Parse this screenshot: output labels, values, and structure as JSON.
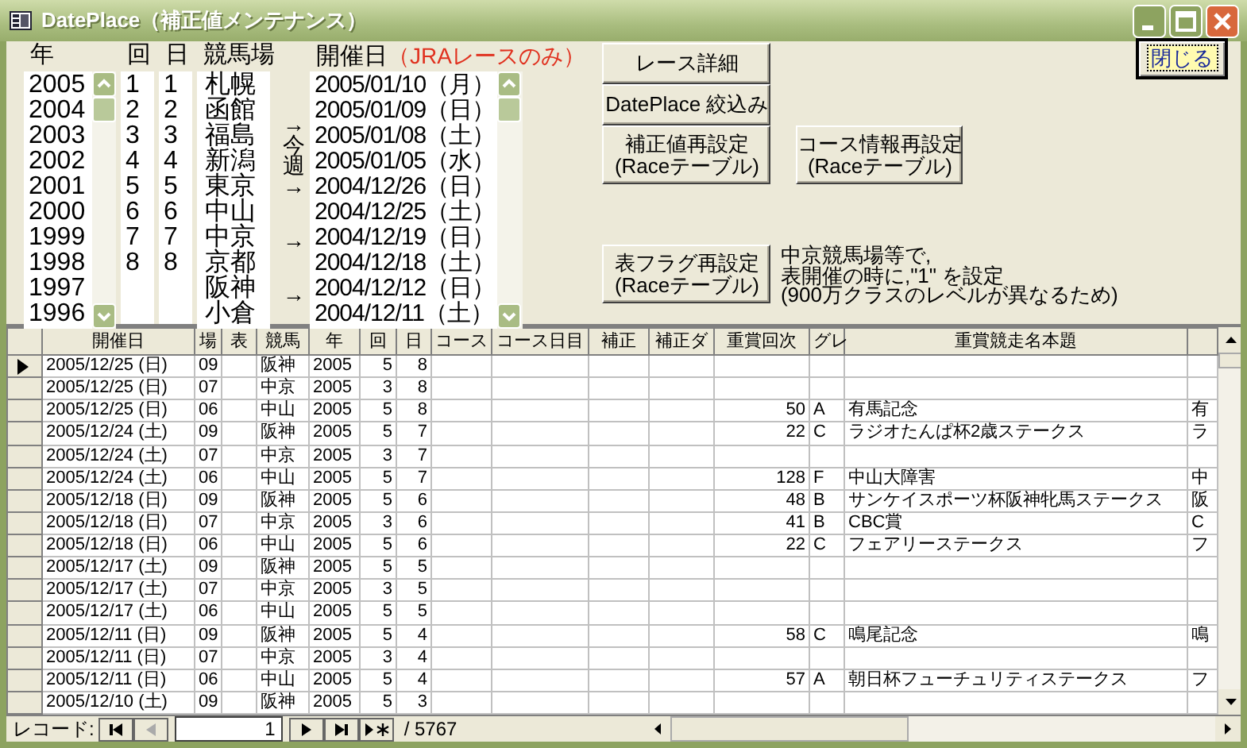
{
  "window": {
    "title": "DatePlace（補正値メンテナンス）"
  },
  "filters": {
    "year": {
      "label": "年",
      "items": [
        "2005",
        "2004",
        "2003",
        "2002",
        "2001",
        "2000",
        "1999",
        "1998",
        "1997",
        "1996"
      ]
    },
    "round": {
      "label": "回",
      "items": [
        "1",
        "2",
        "3",
        "4",
        "5",
        "6",
        "7",
        "8"
      ]
    },
    "day": {
      "label": "日",
      "items": [
        "1",
        "2",
        "3",
        "4",
        "5",
        "6",
        "7",
        "8"
      ]
    },
    "course": {
      "label": "競馬場",
      "items": [
        "札幌",
        "函館",
        "福島",
        "新潟",
        "東京",
        "中山",
        "中京",
        "京都",
        "阪神",
        "小倉"
      ]
    },
    "markers": [
      {
        "kind": "vertical",
        "text": "→今週→"
      },
      {
        "kind": "arrow",
        "text": "→"
      },
      {
        "kind": "arrow",
        "text": "→"
      }
    ],
    "date": {
      "label": "開催日",
      "note": "（JRAレースのみ）",
      "items": [
        "2005/01/10（月）",
        "2005/01/09（日）",
        "2005/01/08（土）",
        "2005/01/05（水）",
        "2004/12/26（日）",
        "2004/12/25（土）",
        "2004/12/19（日）",
        "2004/12/18（土）",
        "2004/12/12（日）",
        "2004/12/11（土）"
      ]
    }
  },
  "buttons": {
    "race_detail": "レース詳細",
    "narrow": "DatePlace 絞込み",
    "reset_adjust": [
      "補正値再設定",
      "(Raceテーブル)"
    ],
    "reset_course": [
      "コース情報再設定",
      "(Raceテーブル)"
    ],
    "reset_flag": [
      "表フラグ再設定",
      "(Raceテーブル)"
    ],
    "close": "閉じる"
  },
  "note": [
    "中京競馬場等で,",
    "表開催の時に,\"1\" を設定",
    "(900万クラスのレベルが異なるため)"
  ],
  "table": {
    "columns": [
      "開催日",
      "場",
      "表",
      "競馬",
      "年",
      "回",
      "日",
      "コース",
      "コース日目",
      "補正",
      "補正ダ",
      "重賞回次",
      "グレ",
      "重賞競走名本題"
    ],
    "rows": [
      {
        "selected": true,
        "date": "2005/12/25 (日)",
        "place": "09",
        "name": "阪神",
        "year": "2005",
        "round": "5",
        "day": "8"
      },
      {
        "selected": false,
        "date": "2005/12/25 (日)",
        "place": "07",
        "name": "中京",
        "year": "2005",
        "round": "3",
        "day": "8"
      },
      {
        "selected": false,
        "date": "2005/12/25 (日)",
        "place": "06",
        "name": "中山",
        "year": "2005",
        "round": "5",
        "day": "8",
        "grade_no": "50",
        "grade": "A",
        "race_title": "有馬記念",
        "column_15": "有"
      },
      {
        "selected": false,
        "date": "2005/12/24 (土)",
        "place": "09",
        "name": "阪神",
        "year": "2005",
        "round": "5",
        "day": "7",
        "grade_no": "22",
        "grade": "C",
        "race_title": "ラジオたんぱ杯2歳ステークス",
        "column_15": "ラ"
      },
      {
        "selected": false,
        "date": "2005/12/24 (土)",
        "place": "07",
        "name": "中京",
        "year": "2005",
        "round": "3",
        "day": "7"
      },
      {
        "selected": false,
        "date": "2005/12/24 (土)",
        "place": "06",
        "name": "中山",
        "year": "2005",
        "round": "5",
        "day": "7",
        "grade_no": "128",
        "grade": "F",
        "race_title": "中山大障害",
        "column_15": "中"
      },
      {
        "selected": false,
        "date": "2005/12/18 (日)",
        "place": "09",
        "name": "阪神",
        "year": "2005",
        "round": "5",
        "day": "6",
        "grade_no": "48",
        "grade": "B",
        "race_title": "サンケイスポーツ杯阪神牝馬ステークス",
        "column_15": "阪"
      },
      {
        "selected": false,
        "date": "2005/12/18 (日)",
        "place": "07",
        "name": "中京",
        "year": "2005",
        "round": "3",
        "day": "6",
        "grade_no": "41",
        "grade": "B",
        "race_title": "CBC賞",
        "column_15": "C"
      },
      {
        "selected": false,
        "date": "2005/12/18 (日)",
        "place": "06",
        "name": "中山",
        "year": "2005",
        "round": "5",
        "day": "6",
        "grade_no": "22",
        "grade": "C",
        "race_title": "フェアリーステークス",
        "column_15": "フ"
      },
      {
        "selected": false,
        "date": "2005/12/17 (土)",
        "place": "09",
        "name": "阪神",
        "year": "2005",
        "round": "5",
        "day": "5"
      },
      {
        "selected": false,
        "date": "2005/12/17 (土)",
        "place": "07",
        "name": "中京",
        "year": "2005",
        "round": "3",
        "day": "5"
      },
      {
        "selected": false,
        "date": "2005/12/17 (土)",
        "place": "06",
        "name": "中山",
        "year": "2005",
        "round": "5",
        "day": "5"
      },
      {
        "selected": false,
        "date": "2005/12/11 (日)",
        "place": "09",
        "name": "阪神",
        "year": "2005",
        "round": "5",
        "day": "4",
        "grade_no": "58",
        "grade": "C",
        "race_title": "鳴尾記念",
        "column_15": "鳴"
      },
      {
        "selected": false,
        "date": "2005/12/11 (日)",
        "place": "07",
        "name": "中京",
        "year": "2005",
        "round": "3",
        "day": "4"
      },
      {
        "selected": false,
        "date": "2005/12/11 (日)",
        "place": "06",
        "name": "中山",
        "year": "2005",
        "round": "5",
        "day": "4",
        "grade_no": "57",
        "grade": "A",
        "race_title": "朝日杯フューチュリティステークス",
        "column_15": "フ"
      },
      {
        "selected": false,
        "date": "2005/12/10 (土)",
        "place": "09",
        "name": "阪神",
        "year": "2005",
        "round": "5",
        "day": "3"
      }
    ]
  },
  "navigation": {
    "label": "レコード:",
    "current": "1",
    "total": "/ 5767"
  }
}
